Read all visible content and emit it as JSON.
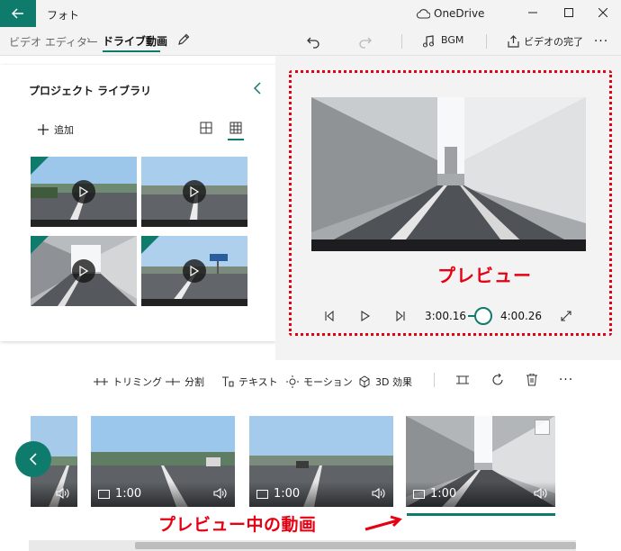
{
  "titlebar": {
    "app_title": "フォト",
    "onedrive_label": "OneDrive"
  },
  "command_bar": {
    "breadcrumb_parent": "ビデオ エディター",
    "breadcrumb_current": "ドライブ動画",
    "bgm_label": "BGM",
    "finish_label": "ビデオの完了"
  },
  "library": {
    "title": "プロジェクト ライブラリ",
    "add_label": "追加",
    "thumbnails": [
      {
        "scene": "road-day"
      },
      {
        "scene": "road-day"
      },
      {
        "scene": "tunnel"
      },
      {
        "scene": "road-sign"
      }
    ]
  },
  "preview": {
    "annotation": "プレビュー",
    "current_time": "3:00.16",
    "total_time": "4:00.26",
    "progress": 0.75
  },
  "storyboard_toolbar": {
    "trim_label": "トリミング",
    "split_label": "分割",
    "text_label": "テキスト",
    "motion_label": "モーション",
    "effects_label": "3D 効果"
  },
  "storyboard": {
    "clips": [
      {
        "duration": "",
        "scene": "road-day"
      },
      {
        "duration": "1:00",
        "scene": "road-day"
      },
      {
        "duration": "1:00",
        "scene": "road-day"
      },
      {
        "duration": "1:00",
        "scene": "tunnel"
      }
    ],
    "annotation": "プレビュー中の動画"
  },
  "colors": {
    "accent": "#0f7b6c",
    "annotation_red": "#e60012"
  }
}
